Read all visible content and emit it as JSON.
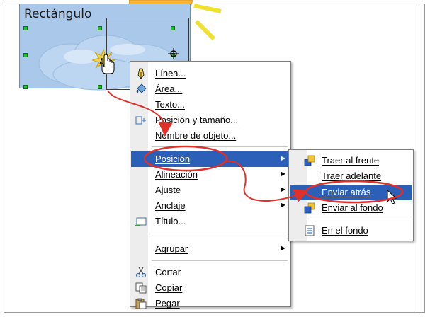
{
  "canvas": {
    "shape_label": "Rectángulo"
  },
  "context_menu": {
    "items": [
      {
        "label": "Línea...",
        "icon": "pen-icon"
      },
      {
        "label": "Área...",
        "icon": "paint-bucket-icon"
      },
      {
        "label": "Texto...",
        "icon": ""
      },
      {
        "label": "Posición y tamaño...",
        "icon": "position-size-icon"
      },
      {
        "label": "Nombre de objeto...",
        "icon": ""
      },
      {
        "label": "Posición",
        "has_submenu": true,
        "selected": true
      },
      {
        "label": "Alineación",
        "has_submenu": true
      },
      {
        "label": "Ajuste",
        "has_submenu": true
      },
      {
        "label": "Anclaje",
        "has_submenu": true
      },
      {
        "label": "Título...",
        "icon": "title-icon"
      },
      {
        "label": "Agrupar",
        "has_submenu": true
      },
      {
        "label": "Cortar",
        "icon": "scissors-icon"
      },
      {
        "label": "Copiar",
        "icon": "copy-icon"
      },
      {
        "label": "Pegar",
        "icon": "paste-icon"
      }
    ]
  },
  "submenu_position": {
    "items": [
      {
        "label": "Traer al frente",
        "icon": "bring-front-icon"
      },
      {
        "label": "Traer adelante",
        "icon": ""
      },
      {
        "label": "Enviar atrás",
        "icon": "",
        "selected": true
      },
      {
        "label": "Enviar al fondo",
        "icon": "send-back-icon"
      },
      {
        "label": "En el fondo",
        "icon": "background-icon"
      }
    ]
  },
  "colors": {
    "menu_highlight": "#2c5fb8",
    "annotation_red": "#e0302a",
    "rect_fill": "#a9c8ea",
    "handle_green": "#22c422"
  }
}
